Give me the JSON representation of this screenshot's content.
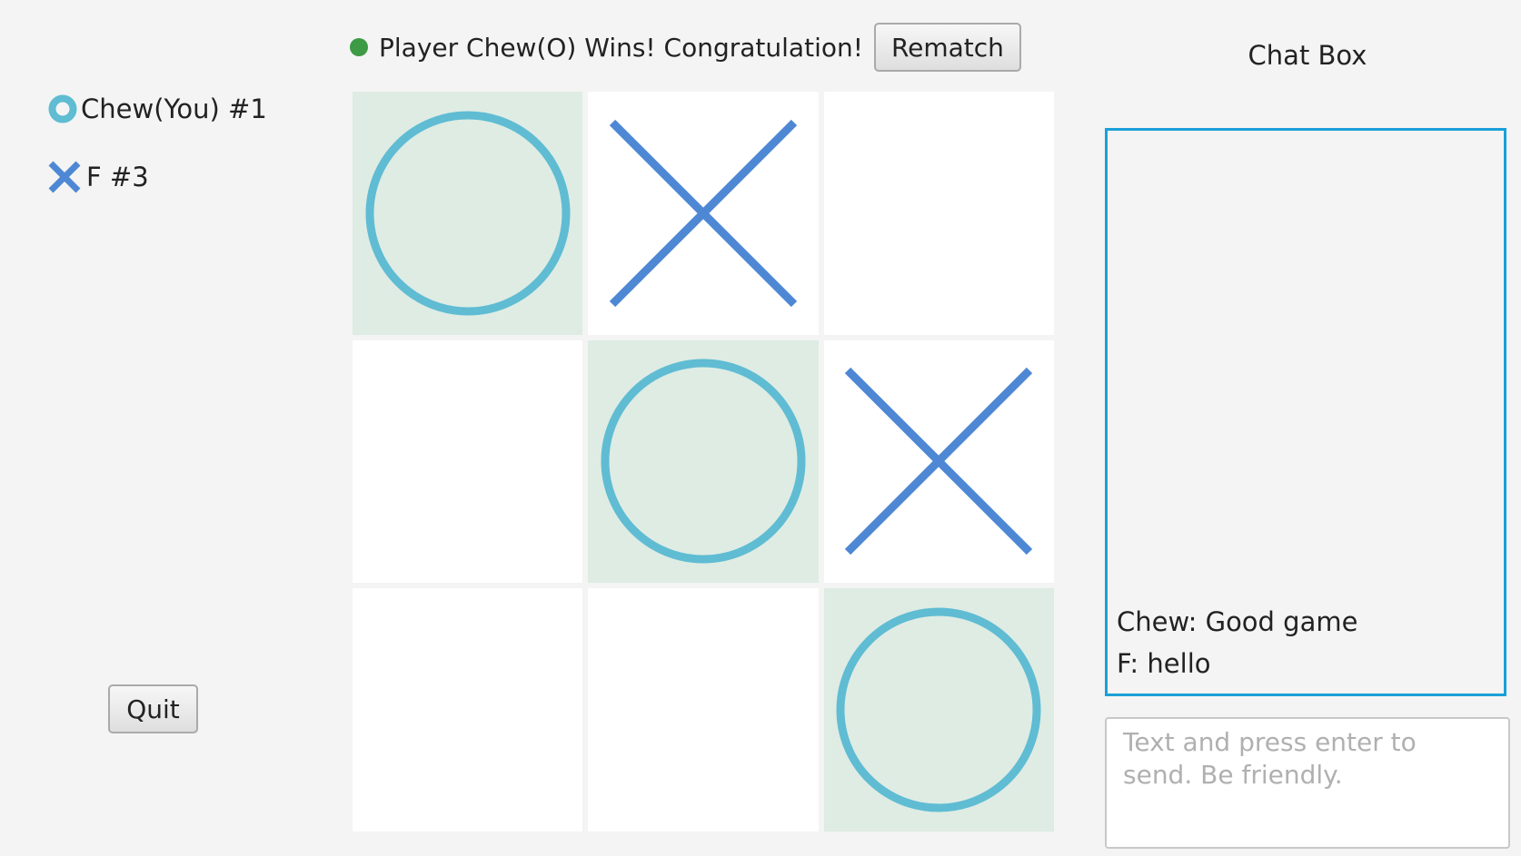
{
  "status": {
    "text": "Player Chew(O) Wins! Congratulation!",
    "dot_color": "#3d9a45",
    "rematch_label": "Rematch"
  },
  "players": [
    {
      "name": "Chew(You) #1",
      "icon": "o-mark-icon",
      "color": "#5fbcd3"
    },
    {
      "name": "F #3",
      "icon": "x-mark-icon",
      "color": "#4e88d4"
    }
  ],
  "board": {
    "cells": [
      "O",
      "X",
      "",
      "",
      "O",
      "X",
      "",
      "",
      "O"
    ],
    "winning_cells": [
      0,
      4,
      8
    ],
    "o_color": "#5fbcd3",
    "x_color": "#4e88d4",
    "win_bg": "#deece4"
  },
  "quit_label": "Quit",
  "chat": {
    "title": "Chat Box",
    "messages": [
      "Chew: Good game",
      "F: hello"
    ],
    "input_placeholder": "Text and press enter to send. Be friendly."
  }
}
